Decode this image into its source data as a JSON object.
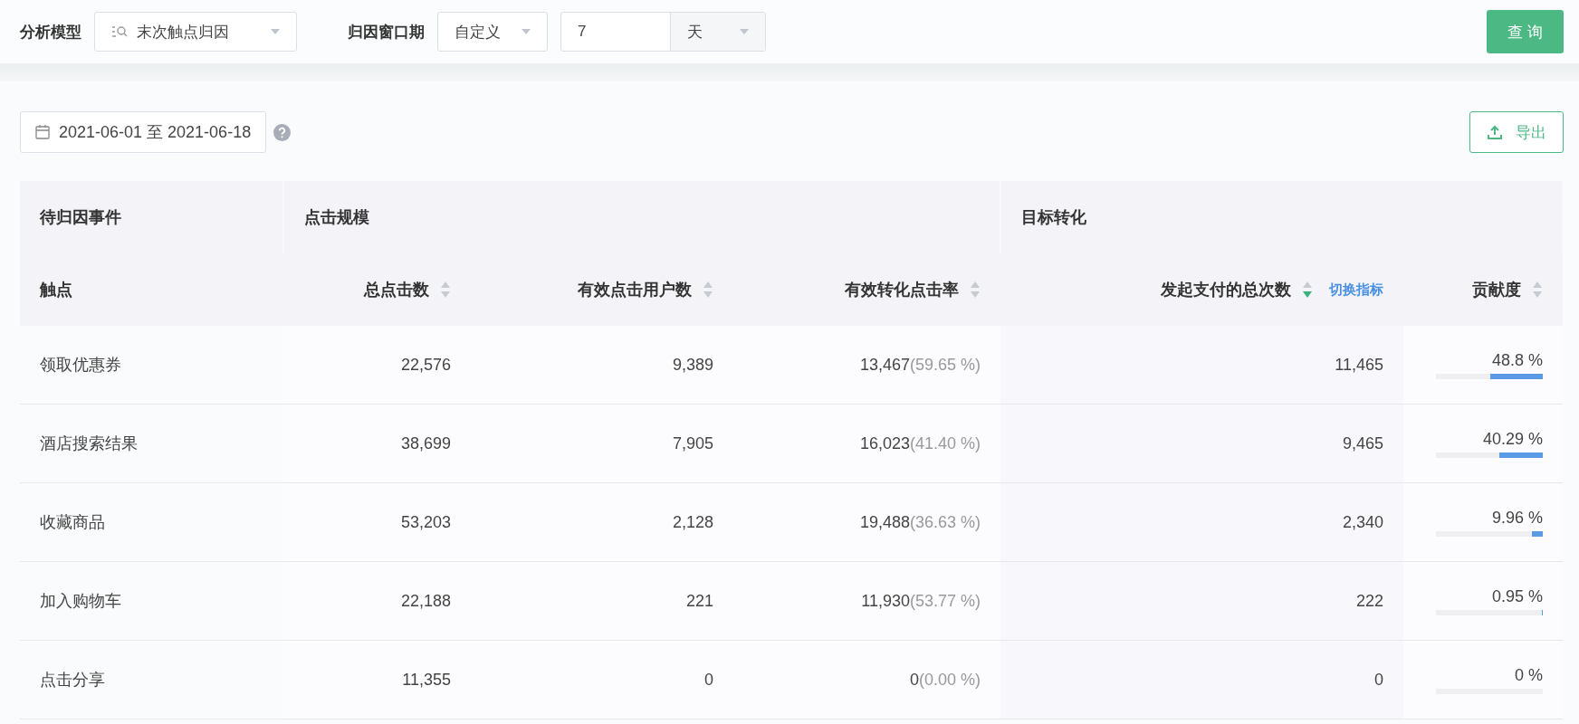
{
  "filters": {
    "model_label": "分析模型",
    "model_value": "末次触点归因",
    "window_label": "归因窗口期",
    "window_mode": "自定义",
    "window_days": "7",
    "window_unit": "天",
    "query_button": "查 询"
  },
  "date_range": "2021-06-01 至 2021-06-18",
  "export_button": "导出",
  "table": {
    "groups": [
      {
        "label": "待归因事件",
        "columns": [
          {
            "label": "触点",
            "sortable": false
          }
        ]
      },
      {
        "label": "点击规模",
        "columns": [
          {
            "label": "总点击数",
            "sortable": true,
            "sorted": false
          },
          {
            "label": "有效点击用户数",
            "sortable": true,
            "sorted": false
          },
          {
            "label": "有效转化点击率",
            "sortable": true,
            "sorted": false
          }
        ]
      },
      {
        "label": "目标转化",
        "columns": [
          {
            "label": "发起支付的总次数",
            "sortable": true,
            "sorted": true,
            "link": "切换指标"
          },
          {
            "label": "贡献度",
            "sortable": true,
            "sorted": false
          }
        ]
      }
    ],
    "rows": [
      {
        "touchpoint": "领取优惠券",
        "clicks": "22,576",
        "users": "9,389",
        "conversions": "13,467",
        "rate": "(59.65 %)",
        "payments": "11,465",
        "contribution": "48.8 %",
        "level": 0.488
      },
      {
        "touchpoint": "酒店搜索结果",
        "clicks": "38,699",
        "users": "7,905",
        "conversions": "16,023",
        "rate": "(41.40 %)",
        "payments": "9,465",
        "contribution": "40.29 %",
        "level": 0.4029
      },
      {
        "touchpoint": "收藏商品",
        "clicks": "53,203",
        "users": "2,128",
        "conversions": "19,488",
        "rate": "(36.63 %)",
        "payments": "2,340",
        "contribution": "9.96 %",
        "level": 0.0996
      },
      {
        "touchpoint": "加入购物车",
        "clicks": "22,188",
        "users": "221",
        "conversions": "11,930",
        "rate": "(53.77 %)",
        "payments": "222",
        "contribution": "0.95 %",
        "level": 0.0095
      },
      {
        "touchpoint": "点击分享",
        "clicks": "11,355",
        "users": "0",
        "conversions": "0",
        "rate": "(0.00 %)",
        "payments": "0",
        "contribution": "0 %",
        "level": 0
      }
    ]
  }
}
